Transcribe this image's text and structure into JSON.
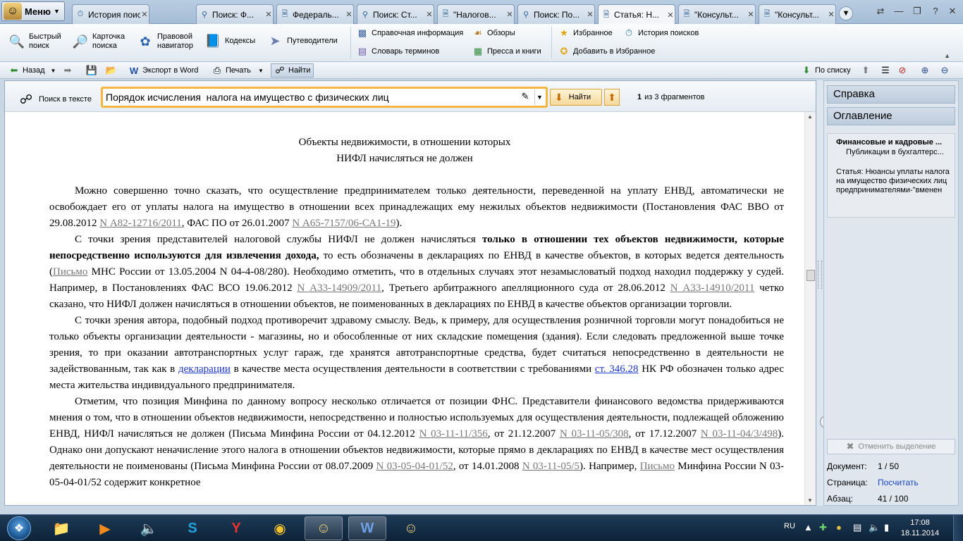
{
  "menu": {
    "label": "Меню"
  },
  "tabs": [
    {
      "label": "История поисков",
      "icon": "history-icon"
    },
    {
      "label": "Поиск: Ф...",
      "icon": "search-icon"
    },
    {
      "label": "Федераль...",
      "icon": "document-icon"
    },
    {
      "label": "Поиск: Ст...",
      "icon": "search-icon"
    },
    {
      "label": "\"Налогов...",
      "icon": "document-icon"
    },
    {
      "label": "Поиск: По...",
      "icon": "search-icon"
    },
    {
      "label": "Статья: Н...",
      "icon": "document-icon",
      "active": true
    },
    {
      "label": "\"Консульт...",
      "icon": "document-icon"
    },
    {
      "label": "\"Консульт...",
      "icon": "document-icon"
    }
  ],
  "ribbon": {
    "quick_search": "Быстрый\nпоиск",
    "search_card": "Карточка\nпоиска",
    "legal_navigator": "Правовой\nнавигатор",
    "codes": "Кодексы",
    "guides": "Путеводители",
    "reference_info": "Справочная информация",
    "dictionary": "Словарь терминов",
    "reviews": "Обзоры",
    "press_books": "Пресса и книги",
    "favorites": "Избранное",
    "add_favorites": "Добавить в Избранное",
    "search_history": "История поисков"
  },
  "toolbar": {
    "back": "Назад",
    "export_word": "Экспорт в Word",
    "print": "Печать",
    "find": "Найти",
    "by_list": "По списку"
  },
  "search": {
    "label": "Поиск в тексте",
    "value": "Порядок исчисления  налога на имущество с физических лиц",
    "find_button": "Найти",
    "current": "1",
    "count_text": "из 3 фрагментов"
  },
  "document": {
    "title_line1": "Объекты недвижимости, в отношении которых",
    "title_line2": "НИФЛ начисляться не должен",
    "p1_a": "Можно совершенно точно сказать, что осуществление предпринимателем только деятельности, переведенной на уплату ЕНВД, автоматически не освобождает его от уплаты налога на имущество в отношении всех принадлежащих ему нежилых объектов недвижимости (Постановления ФАС ВВО от 29.08.2012 ",
    "p1_link1": "N А82-12716/2011",
    "p1_b": ", ФАС ПО от 26.01.2007 ",
    "p1_link2": "N А65-7157/06-СА1-19",
    "p1_c": ").",
    "p2_a": "С точки зрения представителей налоговой службы НИФЛ не должен начисляться ",
    "p2_bold": "только в отношении тех объектов недвижимости, которые непосредственно используются для извлечения дохода,",
    "p2_b": " то есть обозначены в декларациях по ЕНВД в качестве объектов, в которых ведется деятельность (",
    "p2_link1": "Письмо",
    "p2_c": " МНС России от 13.05.2004 N 04-4-08/280). Необходимо отметить, что в отдельных случаях этот незамысловатый подход находил поддержку у судей. Например, в Постановлениях ФАС ВСО 19.06.2012 ",
    "p2_link2": "N А33-14909/2011",
    "p2_d": ", Третьего арбитражного апелляционного суда от 28.06.2012 ",
    "p2_link3": "N А33-14910/2011",
    "p2_e": " четко сказано, что НИФЛ должен начисляться в отношении объектов, не поименованных в декларациях по ЕНВД в качестве объектов организации торговли.",
    "p3_a": "С точки зрения автора, подобный подход противоречит здравому смыслу. Ведь, к примеру, для осуществления розничной торговли могут понадобиться не только объекты организации деятельности - магазины, но и обособленные от них складские помещения (здания). Если следовать предложенной выше точке зрения, то при оказании автотранспортных услуг гараж, где хранятся автотранспортные средства, будет считаться непосредственно в деятельности не задействованным, так как в ",
    "p3_link1": "декларации",
    "p3_b": " в качестве места осуществления деятельности в соответствии с требованиями ",
    "p3_link2": "ст. 346.28",
    "p3_c": " НК РФ обозначен только адрес места жительства индивидуального предпринимателя.",
    "p4_a": "Отметим, что позиция Минфина по данному вопросу несколько отличается от позиции ФНС. Представители финансового ведомства придерживаются мнения о том, что в отношении объектов недвижимости, непосредственно и полностью используемых для осуществления деятельности, подлежащей обложению ЕНВД, НИФЛ начисляться не должен (Письма Минфина России от 04.12.2012 ",
    "p4_link1": "N 03-11-11/356",
    "p4_b": ", от 21.12.2007 ",
    "p4_link2": "N 03-11-05/308",
    "p4_c": ", от 17.12.2007 ",
    "p4_link3": "N 03-11-04/3/498",
    "p4_d": "). Однако они допускают неначисление этого налога в отношении объектов недвижимости, которые прямо в декларациях по ЕНВД в качестве мест осуществления деятельности не поименованы (Письма Минфина России от 08.07.2009 ",
    "p4_link4": "N 03-05-04-01/52",
    "p4_e": ", от 14.01.2008 ",
    "p4_link5": "N 03-11-05/5",
    "p4_f": "). Например, ",
    "p4_link6": "Письмо",
    "p4_g": " Минфина России N 03-05-04-01/52 содержит конкретное"
  },
  "right_panel": {
    "help": "Справка",
    "contents": "Оглавление",
    "card_title": "Финансовые и кадровые ...",
    "card_subtitle": "Публикации в бухгалтерс...",
    "card_text": "Статья: Нюансы уплаты налога на имущество физических лиц предпринимателями-\"вменен",
    "unselect": "Отменить выделение",
    "doc_label": "Документ:",
    "doc_value": "1 / 50",
    "page_label": "Страница:",
    "page_link": "Посчитать",
    "para_label": "Абзац:",
    "para_value": "41 / 100"
  },
  "taskbar": {
    "lang": "RU",
    "time": "17:08",
    "date": "18.11.2014"
  }
}
